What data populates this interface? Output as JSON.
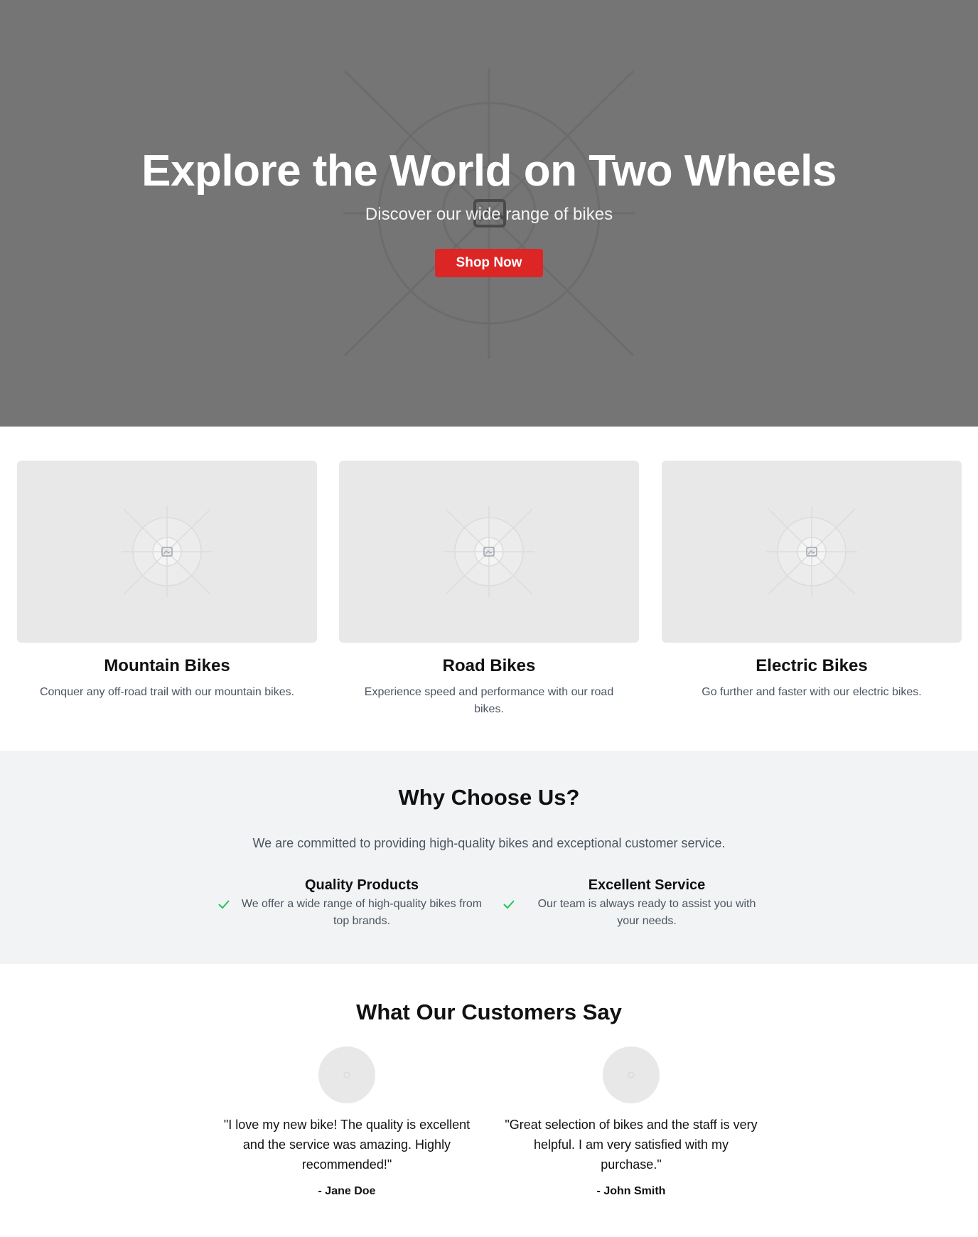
{
  "hero": {
    "title": "Explore the World on Two Wheels",
    "subtitle": "Discover our wide range of bikes",
    "cta_label": "Shop Now",
    "cta_color": "#dc2626",
    "background_color": "#757575",
    "image_icon": "image-placeholder-icon"
  },
  "categories": [
    {
      "title": "Mountain Bikes",
      "description": "Conquer any off-road trail with our mountain bikes.",
      "image_icon": "image-placeholder-icon"
    },
    {
      "title": "Road Bikes",
      "description": "Experience speed and performance with our road bikes.",
      "image_icon": "image-placeholder-icon"
    },
    {
      "title": "Electric Bikes",
      "description": "Go further and faster with our electric bikes.",
      "image_icon": "image-placeholder-icon"
    }
  ],
  "why": {
    "title": "Why Choose Us?",
    "subtitle": "We are committed to providing high-quality bikes and exceptional customer service.",
    "features": [
      {
        "icon": "check-icon",
        "title": "Quality Products",
        "description": "We offer a wide range of high-quality bikes from top brands."
      },
      {
        "icon": "check-icon",
        "title": "Excellent Service",
        "description": "Our team is always ready to assist you with your needs."
      }
    ],
    "check_color": "#22c55e"
  },
  "testimonials": {
    "title": "What Our Customers Say",
    "items": [
      {
        "avatar_icon": "avatar-placeholder-icon",
        "quote": "\"I love my new bike! The quality is excellent and the service was amazing. Highly recommended!\"",
        "author": "- Jane Doe"
      },
      {
        "avatar_icon": "avatar-placeholder-icon",
        "quote": "\"Great selection of bikes and the staff is very helpful. I am very satisfied with my purchase.\"",
        "author": "- John Smith"
      }
    ]
  }
}
